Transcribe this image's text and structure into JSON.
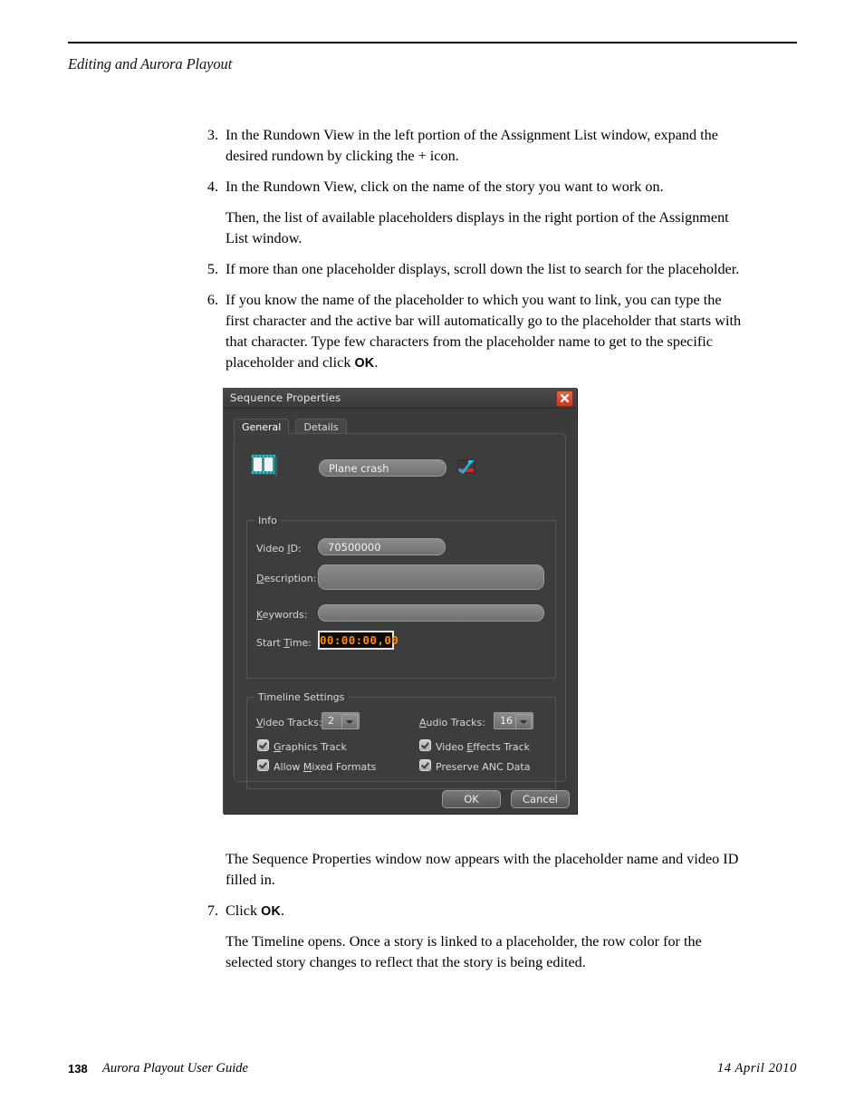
{
  "page": {
    "running_head": "Editing and Aurora Playout",
    "footer": {
      "page_number": "138",
      "guide_title": "Aurora Playout User Guide",
      "date": "14  April  2010"
    }
  },
  "steps": [
    {
      "number": "3.",
      "text": "In the Rundown View in the left portion of the Assignment List window, expand the desired rundown by clicking the + icon."
    },
    {
      "number": "4.",
      "text": "In the Rundown View, click on the name of the story you want to work on."
    }
  ],
  "paragraphs": {
    "after_step4": "Then, the list of available placeholders displays in the right portion of the Assignment List window.",
    "after_dialog": "The Sequence Properties window now appears with the placeholder name and video ID filled in.",
    "after_step7": "The Timeline opens. Once a story is linked to a placeholder, the row color for the selected story changes to reflect that the story is being edited."
  },
  "steps_cont": [
    {
      "number": "5.",
      "text": "If more than one placeholder displays, scroll down the list to search for the placeholder."
    },
    {
      "number": "6.",
      "text_before_kbd": "If you know the name of the placeholder to which you want to link, you can type the first character and the active bar will automatically go to the placeholder that starts with that character. Type few characters from the placeholder name to get to the specific placeholder and click ",
      "kbd": "OK",
      "text_after_kbd": "."
    },
    {
      "number": "7.",
      "text_before_kbd": "Click ",
      "kbd": "OK",
      "text_after_kbd": "."
    }
  ],
  "dialog": {
    "title": "Sequence Properties",
    "close_icon": "close-icon",
    "tabs": [
      {
        "label": "General",
        "active": true
      },
      {
        "label": "Details",
        "active": false
      }
    ],
    "sequence_icon": "filmstrip-icon",
    "name_value": "Plane crash",
    "link_icon": "link-check-icon",
    "info": {
      "legend": "Info",
      "video_id": {
        "label_pre": "Video ",
        "label_acc": "I",
        "label_post": "D:",
        "value": "70500000"
      },
      "description": {
        "label_acc": "D",
        "label_post": "escription:",
        "value": ""
      },
      "keywords": {
        "label_acc": "K",
        "label_post": "eywords:",
        "value": ""
      },
      "start_time": {
        "label_pre": "Start ",
        "label_acc": "T",
        "label_post": "ime:",
        "value": "00:00:00,00"
      }
    },
    "timeline": {
      "legend": "Timeline Settings",
      "video_tracks": {
        "label_acc": "V",
        "label_post": "ideo Tracks:",
        "value": "2"
      },
      "audio_tracks": {
        "label_acc": "A",
        "label_post": "udio Tracks:",
        "value": "16"
      },
      "checkboxes": [
        {
          "label_acc": "G",
          "label_post": "raphics Track",
          "label_pre": "",
          "checked": true
        },
        {
          "label_pre": "Allow ",
          "label_acc": "M",
          "label_post": "ixed Formats",
          "checked": true
        },
        {
          "label_pre": "Video ",
          "label_acc": "E",
          "label_post": "ffects Track",
          "checked": true
        },
        {
          "label_pre": "Preserve ANC Data",
          "label_acc": "",
          "label_post": "",
          "checked": true
        }
      ]
    },
    "buttons": {
      "ok": "OK",
      "cancel": "Cancel"
    },
    "colors": {
      "window_bg": "#3b3b3b",
      "panel_bg": "#3d3d3d",
      "field_bg": "#7d7d7d",
      "timecode_fg": "#ff8a14",
      "timecode_bg": "#0c0c0c",
      "close_btn": "#c0392b",
      "icon_teal": "#2f9e9e",
      "icon_cyan": "#21c3ef"
    }
  }
}
